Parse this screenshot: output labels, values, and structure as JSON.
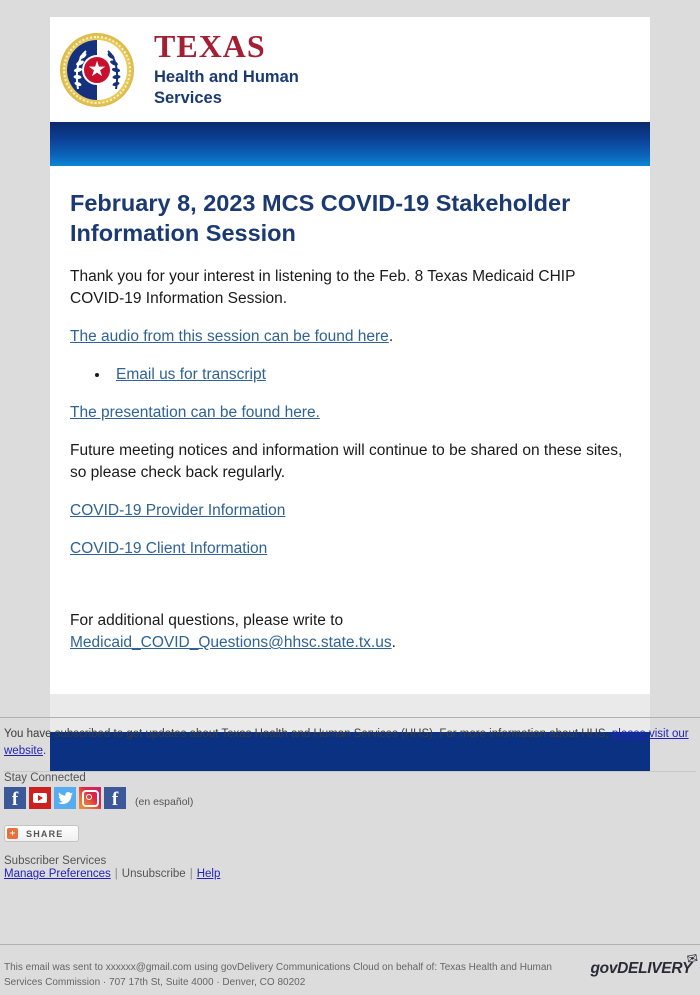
{
  "page": {
    "background_color": "#dcdcdc",
    "card_background": "#ffffff"
  },
  "masthead": {
    "seal_name": "texas-state-seal",
    "star_glyph": "★",
    "wordmark_primary": "TEXAS",
    "wordmark_secondary": "Health and Human\nServices",
    "wordmark_secondary_line1": "Health and Human",
    "wordmark_secondary_line2": "Services",
    "primary_color": "#a31f34",
    "secondary_color": "#1b3a73"
  },
  "banner": {
    "gradient_from": "#0b2a6b",
    "gradient_to": "#0c86d6"
  },
  "content": {
    "headline": "February 8, 2023 MCS COVID-19 Stakeholder Information Session",
    "headline_color": "#1b3a73",
    "intro_paragraph": "Thank you for your interest in listening to the Feb. 8 Texas Medicaid CHIP COVID-19 Information Session.",
    "audio_link_text": "The audio from this session can be found here",
    "audio_link_suffix": ".",
    "bullet_items": [
      {
        "label": "Email us for transcript"
      }
    ],
    "presentation_link_text": "The presentation can be found here.",
    "future_paragraph": "Future meeting notices and information will continue to be shared on these sites, so please check back regularly.",
    "provider_link_text": "COVID-19 Provider Information",
    "client_link_text": "COVID-19 Client Information",
    "questions_prefix": "For additional questions, please write to",
    "questions_email": "Medicaid_COVID_Questions@hhsc.state.tx.us",
    "questions_suffix": ".",
    "link_color": "#2f6296"
  },
  "card_footer": {
    "gray_band_color": "#eaeaea",
    "navy_band_color": "#0a3182"
  },
  "footer": {
    "subscribe_note_prefix": "You have subscribed to get updates about Texas Health and Human Services (HHS). For more information about HHS, ",
    "subscribe_note_link": "please visit our website",
    "subscribe_note_suffix": ".",
    "stay_connected_label": "Stay Connected",
    "social_icons": [
      {
        "name": "facebook-icon",
        "glyph": "f",
        "color": "#3b5998"
      },
      {
        "name": "youtube-icon",
        "glyph": "▶",
        "color": "#cd201f"
      },
      {
        "name": "twitter-icon",
        "glyph": "🐦",
        "color": "#55acee"
      },
      {
        "name": "instagram-icon",
        "glyph": "◻",
        "color": "#dc2743"
      },
      {
        "name": "facebook-espanol-icon",
        "glyph": "f",
        "color": "#3b5998"
      }
    ],
    "espanol_label": "(en español)",
    "share_button_label": "SHARE",
    "share_plus_glyph": "+",
    "subscriber_services_label": "Subscriber Services",
    "manage_preferences_label": "Manage Preferences",
    "unsubscribe_label": "Unsubscribe",
    "help_label": "Help",
    "separator": "|",
    "link_color": "#2222bb"
  },
  "legal": {
    "line1": "This email was sent to xxxxxx@gmail.com using govDelivery Communications Cloud on behalf of: Texas Health and Human",
    "line2": "Services Commission · 707 17th St, Suite 4000 · Denver, CO 80202",
    "govdelivery_wordmark": "govDELIVERY",
    "envelope_glyph": "✉"
  }
}
